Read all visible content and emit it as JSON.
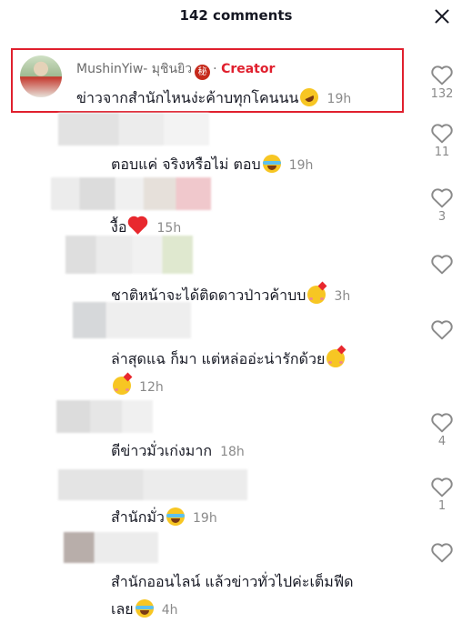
{
  "header": {
    "title": "142 comments"
  },
  "creator_comment": {
    "author": "MushinYiw- มุชินยิว",
    "seal": "秘",
    "separator": "·",
    "tag": "Creator",
    "text": "ข่าวจากสำนักไหนง่ะค้าบทุกโคนนน",
    "time": "19h",
    "likes": "132"
  },
  "replies": [
    {
      "text": "ตอบแค่ จริงหรือไม่ ตอบ",
      "time": "19h",
      "likes": "11"
    },
    {
      "text": "งื้อ",
      "time": "15h",
      "likes": "3"
    },
    {
      "text": "ชาติหน้าจะได้ติดดาวป่าวค้าบบ",
      "time": "3h",
      "likes": ""
    },
    {
      "text": "ล่าสุดแฉ ก็มา แต่หล่ออ่ะน่ารักด้วย",
      "time": "12h",
      "likes": ""
    },
    {
      "text": "ตีข่าวมั่วเก่งมาก",
      "time": "18h",
      "likes": "4"
    },
    {
      "text": "สำนักมั่ว",
      "time": "19h",
      "likes": "1"
    },
    {
      "text": "สำนักออนไลน์ แล้วข่าวทั่วไปค่ะเต็มฟีด",
      "text_line2": "เลย",
      "time": "4h",
      "likes": ""
    }
  ],
  "icons": {
    "close": "close-icon",
    "like": "heart-outline-icon"
  },
  "colors": {
    "creator_accent": "#e0202e",
    "highlight_border": "#e0202e",
    "muted_text": "#8a8a8a"
  }
}
